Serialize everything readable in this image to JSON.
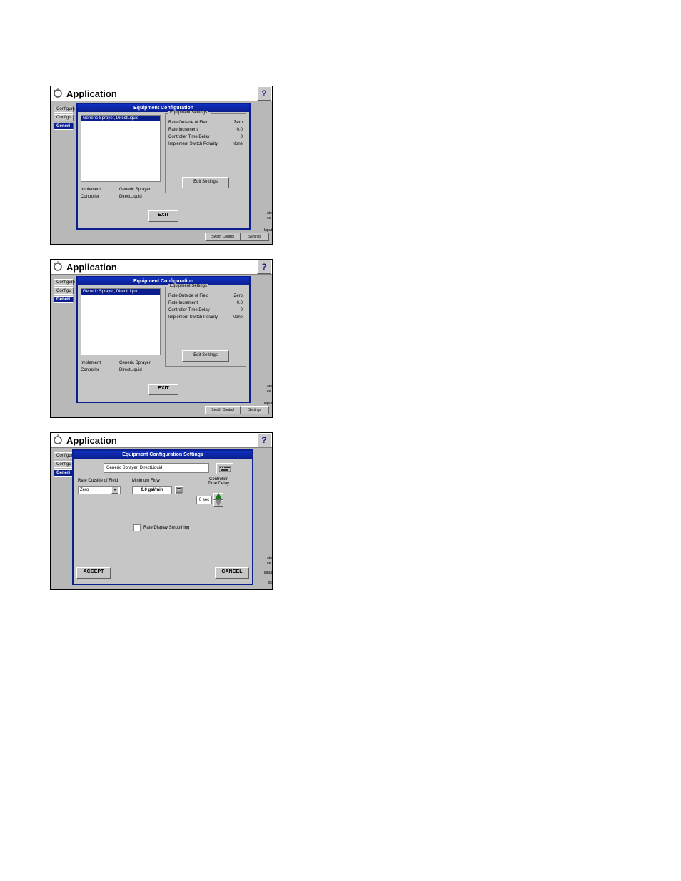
{
  "app_title": "Application",
  "help_glyph": "?",
  "tabs": {
    "t1": "Configure",
    "t2": "Configu",
    "t3": "Generi"
  },
  "background_buttons": {
    "swath": "Swath Control",
    "settings": "Settings"
  },
  "peek": {
    "p1a": "ate",
    "p1b": "ce",
    "p2": "Input"
  },
  "config_modal": {
    "title": "Equipment Configuration",
    "selected_item": "Generic Sprayer, DirectLiquid",
    "implement_label": "Implement",
    "implement_value": "Generic Sprayer",
    "controller_label": "Controller",
    "controller_value": "DirectLiquid",
    "group_label": "Equipment Settings",
    "rows": {
      "r1k": "Rate Outside of Field",
      "r1v": "Zero",
      "r2k": "Rate Increment",
      "r2v": "0.0",
      "r3k": "Controller Time Delay",
      "r3v": "0",
      "r4k": "Implement Switch Polarity",
      "r4v": "None"
    },
    "edit_btn": "Edit Settings",
    "exit_btn": "EXIT"
  },
  "settings_modal": {
    "title": "Equipment Configuration Settings",
    "device": "Generic Sprayer, DirectLiquid",
    "rate_outside_label": "Rate Outside of Field",
    "rate_outside_value": "Zero",
    "min_flow_label": "Minimum Flow",
    "min_flow_value": "0.0 gal/min",
    "delay_label": "Controller\nTime Delay",
    "delay_value": "0 sec",
    "smoothing_label": "Rate Display Smoothing",
    "accept": "ACCEPT",
    "cancel": "CANCEL"
  },
  "peek3": {
    "a": "ate",
    "b": "ce",
    "c": "Input",
    "d": "gs"
  }
}
